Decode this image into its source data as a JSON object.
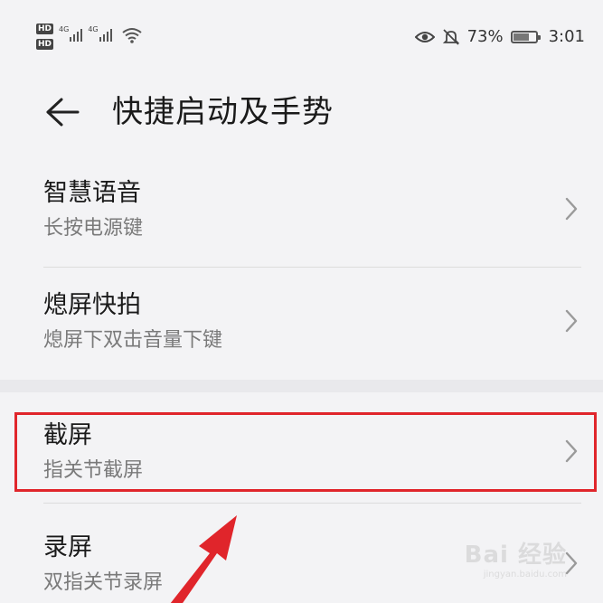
{
  "status_bar": {
    "hd_label": "HD",
    "net_label_1": "4G",
    "net_label_2": "4G",
    "battery_percent_text": "73%",
    "battery_level": 0.73,
    "time": "3:01",
    "icons": [
      "eye-comfort-icon",
      "bell-muted-icon",
      "wifi-icon",
      "battery-icon"
    ]
  },
  "header": {
    "back_icon": "arrow-left-icon",
    "title": "快捷启动及手势"
  },
  "settings": {
    "items": [
      {
        "title": "智慧语音",
        "subtitle": "长按电源键"
      },
      {
        "title": "熄屏快拍",
        "subtitle": "熄屏下双击音量下键"
      },
      {
        "title": "截屏",
        "subtitle": "指关节截屏"
      },
      {
        "title": "录屏",
        "subtitle": "双指关节录屏"
      }
    ]
  },
  "annotation": {
    "highlight_color": "#e0252b",
    "arrow_color": "#e0252b"
  },
  "watermark": {
    "main": "Bai 经验",
    "sub": "jingyan.baidu.com"
  }
}
